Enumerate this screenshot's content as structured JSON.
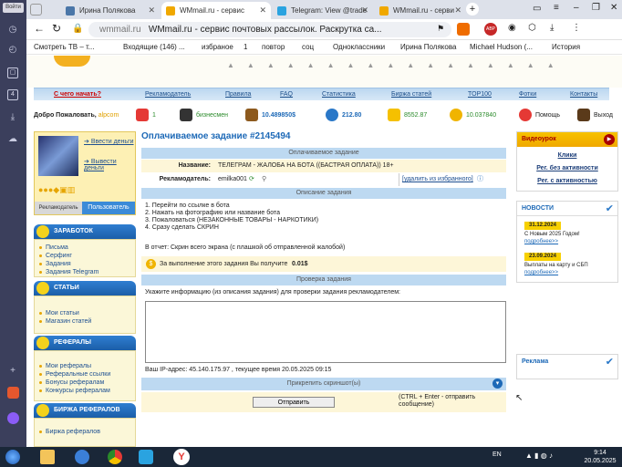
{
  "browser": {
    "sidebar_button": "Войти",
    "tabs": [
      {
        "label": "Ирина Полякова",
        "fav": "#4a76a8",
        "active": false
      },
      {
        "label": "WMmail.ru - сервис",
        "fav": "#f0a800",
        "active": true
      },
      {
        "label": "Telegram: View @trade",
        "fav": "#2aa3e0",
        "active": false
      },
      {
        "label": "WMmail.ru - серви",
        "fav": "#f0a800",
        "active": false
      }
    ],
    "url_host": "wmmail.ru",
    "url_title": "WMmail.ru - сервис почтовых рассылок. Раскрутка са...",
    "bookmarks": [
      "Смотреть ТВ – т...",
      "Входящие (146) ...",
      "избраное",
      "1",
      "повтор",
      "соц",
      "Одноклассники",
      "Ирина Полякова",
      "Michael Hudson (...",
      "История"
    ]
  },
  "nav": {
    "links": [
      "С чего начать?",
      "Рекламодатель",
      "Правила",
      "FAQ",
      "Статистика",
      "Биржа статей",
      "TOP100",
      "Фотки",
      "Контакты"
    ]
  },
  "stats": {
    "welcome": "Добро Пожаловать,",
    "user": "alpcom",
    "num1": "1",
    "biz": "бизнесмен",
    "balance": "10.489850$",
    "s212": "212.80",
    "s8552": "8552.87",
    "s10": "10.037840",
    "help": "Помощь",
    "exit": "Выход"
  },
  "profile": {
    "deposit": "Ввести деньги",
    "withdraw": "Вывести деньги",
    "tab_adv": "Рекламодатель",
    "tab_user": "Пользователь"
  },
  "menu": [
    {
      "title": "ЗАРАБОТОК",
      "items": [
        "Письма",
        "Серфинг",
        "Задания",
        "Задания Telegram"
      ]
    },
    {
      "title": "СТАТЬИ",
      "items": [
        "Мои статьи",
        "Магазин статей"
      ]
    },
    {
      "title": "РЕФЕРАЛЫ",
      "items": [
        "Мои рефералы",
        "Реферальные ссылки",
        "Бонусы рефералам",
        "Конкурсы рефералам"
      ]
    },
    {
      "title": "БИРЖА РЕФЕРАЛОВ",
      "items": [
        "Биржа рефералов"
      ]
    }
  ],
  "task": {
    "title": "Оплачиваемое задание #2145494",
    "hdr_paid": "Оплачиваемое задание",
    "name_label": "Название:",
    "name_value": "ТЕЛЕГРАМ - ЖАЛОБА НА БОТА ((БАСТРАЯ ОПЛАТА)) 18+",
    "adv_label": "Рекламодатель:",
    "adv_value": "emilka001",
    "remove_fav": "[удалить из избранного]",
    "hdr_desc": "Описание задания",
    "steps": [
      "1. Перейти по ссылке в бота",
      "2. Нажать на фотографию или название бота",
      "3. Пожаловаться (НЕЗАКОННЫЕ ТОВАРЫ - НАРКОТИКИ)",
      "4. Сразу сделать СКРИН"
    ],
    "report": "В отчет: Скрин всего экрана (с плашкой об отправленной жалобой)",
    "reward_text": "За выполнение этого задания Вы получите",
    "reward_value": "0.01$",
    "hdr_check": "Проверка задания",
    "check_prompt": "Укажите информацию (из описания задания) для проверки задания рекламодателем:",
    "ip_line": "Ваш IP-адрес: 45.140.175.97 , текущее время 20.05.2025 09:15",
    "attach": "Прикрепить скриншот(ы)",
    "send": "Отправить",
    "hint": "(CTRL + Enter - отправить сообщение)"
  },
  "right": {
    "video_title": "Видеоурок",
    "video_links": [
      "Клики",
      "Рег. без активности",
      "Рег. с активностью"
    ],
    "news_title": "НОВОСТИ",
    "news": [
      {
        "date": "31.12.2024",
        "text": "С Новым 2025 Годом!",
        "more": "подробнее>>"
      },
      {
        "date": "23.09.2024",
        "text": "Выплаты на карту и СБП",
        "more": "подробнее>>"
      }
    ],
    "ads_title": "Реклама"
  },
  "taskbar": {
    "lang": "EN",
    "time": "9:14",
    "date": "20.05.2025"
  }
}
